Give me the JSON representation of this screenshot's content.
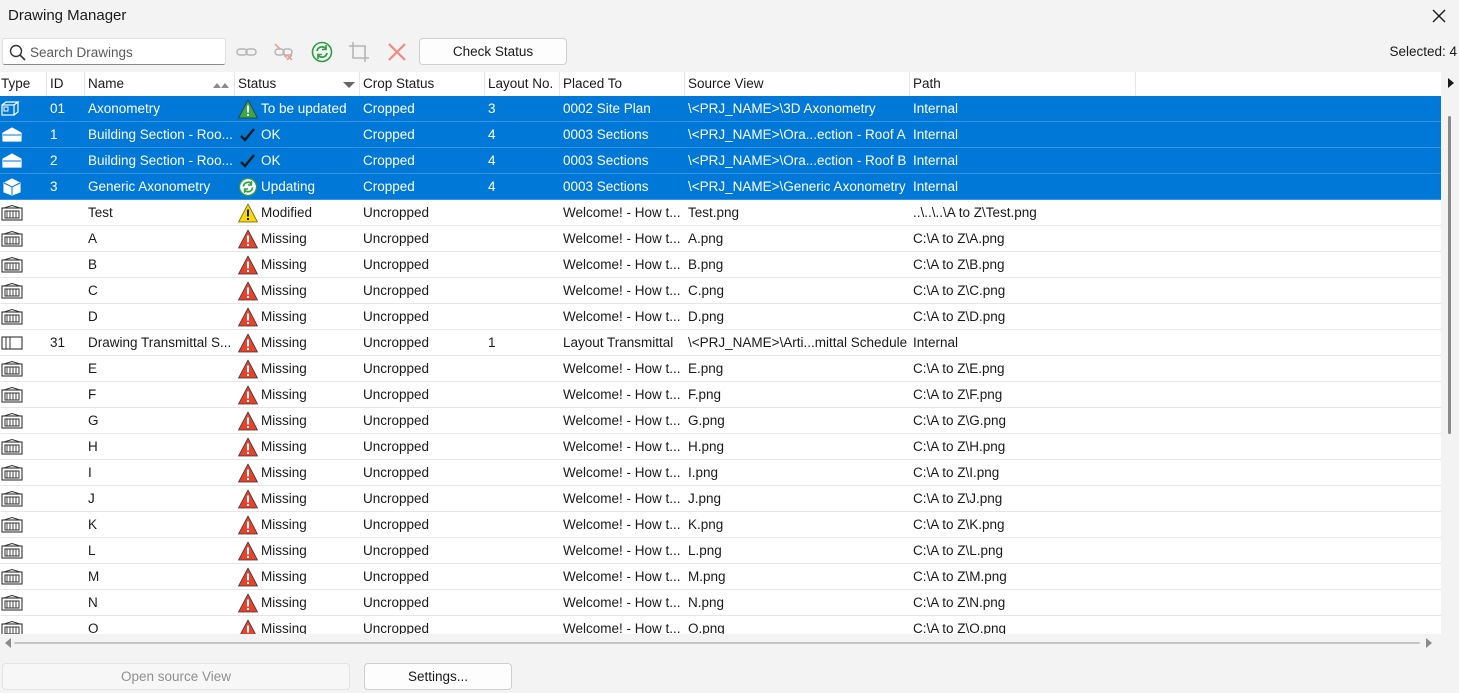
{
  "window": {
    "title": "Drawing Manager"
  },
  "toolbar": {
    "search_placeholder": "Search Drawings",
    "check_status_label": "Check Status",
    "selected_text": "Selected: 4",
    "icons": [
      "link-icon",
      "unlink-icon",
      "refresh-icon",
      "crop-icon",
      "delete-icon"
    ]
  },
  "table": {
    "columns": [
      "Type",
      "ID",
      "Name",
      "Status",
      "Crop Status",
      "Layout No.",
      "Placed To",
      "Source View",
      "Path"
    ],
    "rows": [
      {
        "type_icon": "axonometry-icon",
        "id": "01",
        "name": "Axonometry",
        "status": "To be updated",
        "status_icon": "warning-green",
        "crop": "Cropped",
        "layout": "3",
        "placed": "0002 Site Plan",
        "source": "\\<PRJ_NAME>\\3D Axonometry",
        "path": "Internal",
        "selected": true
      },
      {
        "type_icon": "section-icon",
        "id": "1",
        "name": "Building Section - Roo...",
        "status": "OK",
        "status_icon": "check",
        "crop": "Cropped",
        "layout": "4",
        "placed": "0003 Sections",
        "source": "\\<PRJ_NAME>\\Ora...ection - Roof A",
        "path": "Internal",
        "selected": true
      },
      {
        "type_icon": "section-icon",
        "id": "2",
        "name": "Building Section - Roo...",
        "status": "OK",
        "status_icon": "check",
        "crop": "Cropped",
        "layout": "4",
        "placed": "0003 Sections",
        "source": "\\<PRJ_NAME>\\Ora...ection - Roof B",
        "path": "Internal",
        "selected": true
      },
      {
        "type_icon": "box-icon",
        "id": "3",
        "name": "Generic Axonometry",
        "status": "Updating",
        "status_icon": "updating",
        "crop": "Cropped",
        "layout": "4",
        "placed": "0003 Sections",
        "source": "\\<PRJ_NAME>\\Generic Axonometry",
        "path": "Internal",
        "selected": true
      },
      {
        "type_icon": "image-icon",
        "id": "",
        "name": "Test",
        "status": "Modified",
        "status_icon": "warning-yellow",
        "crop": "Uncropped",
        "layout": "",
        "placed": "Welcome! - How t...",
        "source": "Test.png",
        "path": "..\\..\\..\\A to Z\\Test.png",
        "selected": false
      },
      {
        "type_icon": "image-icon",
        "id": "",
        "name": "A",
        "status": "Missing",
        "status_icon": "warning-red",
        "crop": "Uncropped",
        "layout": "",
        "placed": "Welcome! - How t...",
        "source": "A.png",
        "path": "C:\\A to Z\\A.png",
        "selected": false
      },
      {
        "type_icon": "image-icon",
        "id": "",
        "name": "B",
        "status": "Missing",
        "status_icon": "warning-red",
        "crop": "Uncropped",
        "layout": "",
        "placed": "Welcome! - How t...",
        "source": "B.png",
        "path": "C:\\A to Z\\B.png",
        "selected": false
      },
      {
        "type_icon": "image-icon",
        "id": "",
        "name": "C",
        "status": "Missing",
        "status_icon": "warning-red",
        "crop": "Uncropped",
        "layout": "",
        "placed": "Welcome! - How t...",
        "source": "C.png",
        "path": "C:\\A to Z\\C.png",
        "selected": false
      },
      {
        "type_icon": "image-icon",
        "id": "",
        "name": "D",
        "status": "Missing",
        "status_icon": "warning-red",
        "crop": "Uncropped",
        "layout": "",
        "placed": "Welcome! - How t...",
        "source": "D.png",
        "path": "C:\\A to Z\\D.png",
        "selected": false
      },
      {
        "type_icon": "schedule-icon",
        "id": "31",
        "name": "Drawing Transmittal S...",
        "status": "Missing",
        "status_icon": "warning-red",
        "crop": "Uncropped",
        "layout": "1",
        "placed": "Layout Transmittal",
        "source": "\\<PRJ_NAME>\\Arti...mittal Schedule",
        "path": "Internal",
        "selected": false
      },
      {
        "type_icon": "image-icon",
        "id": "",
        "name": "E",
        "status": "Missing",
        "status_icon": "warning-red",
        "crop": "Uncropped",
        "layout": "",
        "placed": "Welcome! - How t...",
        "source": "E.png",
        "path": "C:\\A to Z\\E.png",
        "selected": false
      },
      {
        "type_icon": "image-icon",
        "id": "",
        "name": "F",
        "status": "Missing",
        "status_icon": "warning-red",
        "crop": "Uncropped",
        "layout": "",
        "placed": "Welcome! - How t...",
        "source": "F.png",
        "path": "C:\\A to Z\\F.png",
        "selected": false
      },
      {
        "type_icon": "image-icon",
        "id": "",
        "name": "G",
        "status": "Missing",
        "status_icon": "warning-red",
        "crop": "Uncropped",
        "layout": "",
        "placed": "Welcome! - How t...",
        "source": "G.png",
        "path": "C:\\A to Z\\G.png",
        "selected": false
      },
      {
        "type_icon": "image-icon",
        "id": "",
        "name": "H",
        "status": "Missing",
        "status_icon": "warning-red",
        "crop": "Uncropped",
        "layout": "",
        "placed": "Welcome! - How t...",
        "source": "H.png",
        "path": "C:\\A to Z\\H.png",
        "selected": false
      },
      {
        "type_icon": "image-icon",
        "id": "",
        "name": "I",
        "status": "Missing",
        "status_icon": "warning-red",
        "crop": "Uncropped",
        "layout": "",
        "placed": "Welcome! - How t...",
        "source": "I.png",
        "path": "C:\\A to Z\\I.png",
        "selected": false
      },
      {
        "type_icon": "image-icon",
        "id": "",
        "name": "J",
        "status": "Missing",
        "status_icon": "warning-red",
        "crop": "Uncropped",
        "layout": "",
        "placed": "Welcome! - How t...",
        "source": "J.png",
        "path": "C:\\A to Z\\J.png",
        "selected": false
      },
      {
        "type_icon": "image-icon",
        "id": "",
        "name": "K",
        "status": "Missing",
        "status_icon": "warning-red",
        "crop": "Uncropped",
        "layout": "",
        "placed": "Welcome! - How t...",
        "source": "K.png",
        "path": "C:\\A to Z\\K.png",
        "selected": false
      },
      {
        "type_icon": "image-icon",
        "id": "",
        "name": "L",
        "status": "Missing",
        "status_icon": "warning-red",
        "crop": "Uncropped",
        "layout": "",
        "placed": "Welcome! - How t...",
        "source": "L.png",
        "path": "C:\\A to Z\\L.png",
        "selected": false
      },
      {
        "type_icon": "image-icon",
        "id": "",
        "name": "M",
        "status": "Missing",
        "status_icon": "warning-red",
        "crop": "Uncropped",
        "layout": "",
        "placed": "Welcome! - How t...",
        "source": "M.png",
        "path": "C:\\A to Z\\M.png",
        "selected": false
      },
      {
        "type_icon": "image-icon",
        "id": "",
        "name": "N",
        "status": "Missing",
        "status_icon": "warning-red",
        "crop": "Uncropped",
        "layout": "",
        "placed": "Welcome! - How t...",
        "source": "N.png",
        "path": "C:\\A to Z\\N.png",
        "selected": false
      },
      {
        "type_icon": "image-icon",
        "id": "",
        "name": "O",
        "status": "Missing",
        "status_icon": "warning-red",
        "crop": "Uncropped",
        "layout": "",
        "placed": "Welcome! - How t...",
        "source": "O.png",
        "path": "C:\\A to Z\\O.png",
        "selected": false
      }
    ]
  },
  "footer": {
    "open_source_label": "Open source View",
    "settings_label": "Settings..."
  },
  "colors": {
    "selection": "#0078d7",
    "warning_red": "#e8412c",
    "warning_yellow": "#f5d90a",
    "warning_green": "#3aa64a",
    "refresh_green": "#2e9d46",
    "delete_red": "#f08a80"
  }
}
